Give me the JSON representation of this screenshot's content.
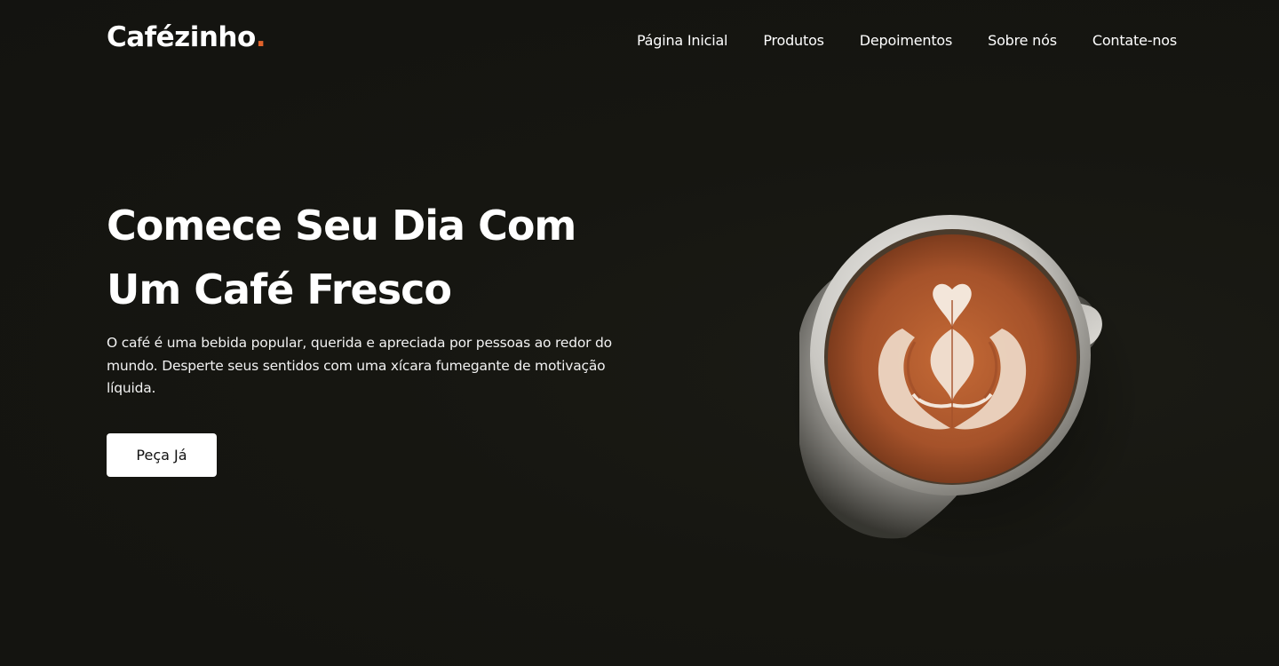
{
  "brand": {
    "name": "Cafézinho",
    "dot": "."
  },
  "nav": {
    "items": [
      {
        "label": "Página Inicial"
      },
      {
        "label": "Produtos"
      },
      {
        "label": "Depoimentos"
      },
      {
        "label": "Sobre nós"
      },
      {
        "label": "Contate-nos"
      }
    ]
  },
  "hero": {
    "title_line_1": "Comece Seu Dia Com",
    "title_line_2": "Um Café Fresco",
    "description": "O café é uma bebida popular, querida e apreciada por pessoas ao redor do mundo. Desperte seus sentidos com uma xícara fumegante de motivação líquida.",
    "cta_label": "Peça Já",
    "image_alt": "Xícara de café com arte latte"
  },
  "colors": {
    "background": "#151510",
    "accent": "#e0622a",
    "text": "#ffffff",
    "button_bg": "#ffffff",
    "button_text": "#111111",
    "coffee": "#a8532a",
    "cup": "#d7d5d0"
  }
}
